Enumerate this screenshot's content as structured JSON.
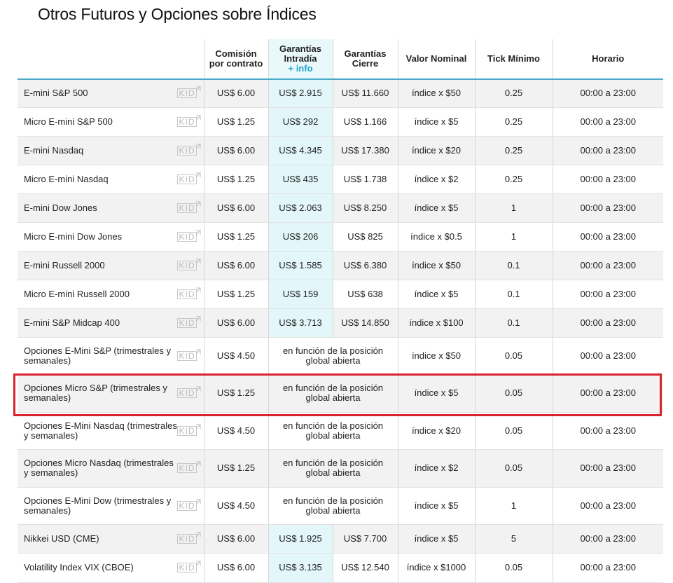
{
  "title": "Otros Futuros y Opciones sobre Índices",
  "headers": {
    "comision": "Comisión por contrato",
    "intradia": "Garantías Intradía",
    "intradia_info": "+ info",
    "cierre": "Garantías Cierre",
    "nominal": "Valor Nominal",
    "tick": "Tick Mínimo",
    "horario": "Horario"
  },
  "kid_label": "KID",
  "rows": [
    {
      "name": "E-mini S&P 500",
      "comision": "US$ 6.00",
      "intradia": "US$ 2.915",
      "cierre": "US$ 11.660",
      "nominal": "índice x $50",
      "tick": "0.25",
      "horario": "00:00 a 23:00"
    },
    {
      "name": "Micro E-mini S&P 500",
      "comision": "US$ 1.25",
      "intradia": "US$ 292",
      "cierre": "US$ 1.166",
      "nominal": "índice x $5",
      "tick": "0.25",
      "horario": "00:00 a 23:00"
    },
    {
      "name": "E-mini Nasdaq",
      "comision": "US$ 6.00",
      "intradia": "US$ 4.345",
      "cierre": "US$ 17.380",
      "nominal": "índice x $20",
      "tick": "0.25",
      "horario": "00:00 a 23:00"
    },
    {
      "name": "Micro E-mini Nasdaq",
      "comision": "US$ 1.25",
      "intradia": "US$ 435",
      "cierre": "US$ 1.738",
      "nominal": "índice x $2",
      "tick": "0.25",
      "horario": "00:00 a 23:00"
    },
    {
      "name": "E-mini Dow Jones",
      "comision": "US$ 6.00",
      "intradia": "US$ 2.063",
      "cierre": "US$ 8.250",
      "nominal": "índice x $5",
      "tick": "1",
      "horario": "00:00 a 23:00"
    },
    {
      "name": "Micro E-mini Dow Jones",
      "comision": "US$ 1.25",
      "intradia": "US$ 206",
      "cierre": "US$ 825",
      "nominal": "índice x $0.5",
      "tick": "1",
      "horario": "00:00 a 23:00"
    },
    {
      "name": "E-mini Russell 2000",
      "comision": "US$ 6.00",
      "intradia": "US$ 1.585",
      "cierre": "US$ 6.380",
      "nominal": "índice x $50",
      "tick": "0.1",
      "horario": "00:00 a 23:00"
    },
    {
      "name": "Micro E-mini Russell 2000",
      "comision": "US$ 1.25",
      "intradia": "US$ 159",
      "cierre": "US$ 638",
      "nominal": "índice x $5",
      "tick": "0.1",
      "horario": "00:00 a 23:00"
    },
    {
      "name": "E-mini S&P Midcap 400",
      "comision": "US$ 6.00",
      "intradia": "US$ 3.713",
      "cierre": "US$ 14.850",
      "nominal": "índice x $100",
      "tick": "0.1",
      "horario": "00:00 a 23:00"
    },
    {
      "name": "Opciones E-Mini S&P (trimestrales y semanales)",
      "comision": "US$ 4.50",
      "garantia": "en función de la posición global abierta",
      "nominal": "índice x $50",
      "tick": "0.05",
      "horario": "00:00 a 23:00"
    },
    {
      "name": "Opciones Micro S&P (trimestrales y semanales)",
      "comision": "US$ 1.25",
      "garantia": "en función de la posición global abierta",
      "nominal": "índice x $5",
      "tick": "0.05",
      "horario": "00:00 a 23:00"
    },
    {
      "name": "Opciones E-Mini Nasdaq (trimestrales y semanales)",
      "comision": "US$ 4.50",
      "garantia": "en función de la posición global abierta",
      "nominal": "índice x $20",
      "tick": "0.05",
      "horario": "00:00 a 23:00"
    },
    {
      "name": "Opciones Micro Nasdaq (trimestrales y semanales)",
      "comision": "US$ 1.25",
      "garantia": "en función de la posición global abierta",
      "nominal": "índice x $2",
      "tick": "0.05",
      "horario": "00:00 a 23:00"
    },
    {
      "name": "Opciones E-Mini Dow (trimestrales y semanales)",
      "comision": "US$ 4.50",
      "garantia": "en función de la posición global abierta",
      "nominal": "índice x $5",
      "tick": "1",
      "horario": "00:00 a 23:00"
    },
    {
      "name": "Nikkei USD (CME)",
      "comision": "US$ 6.00",
      "intradia": "US$ 1.925",
      "cierre": "US$ 7.700",
      "nominal": "índice x $5",
      "tick": "5",
      "horario": "00:00 a 23:00"
    },
    {
      "name": "Volatility Index VIX (CBOE)",
      "comision": "US$ 6.00",
      "intradia": "US$ 3.135",
      "cierre": "US$ 12.540",
      "nominal": "índice x $1000",
      "tick": "0.05",
      "horario": "00:00 a 23:00"
    }
  ],
  "colors": {
    "accent": "#1fa6cf",
    "highlight_border": "#d9232e",
    "intradia_bg": "#e3f7fb"
  }
}
